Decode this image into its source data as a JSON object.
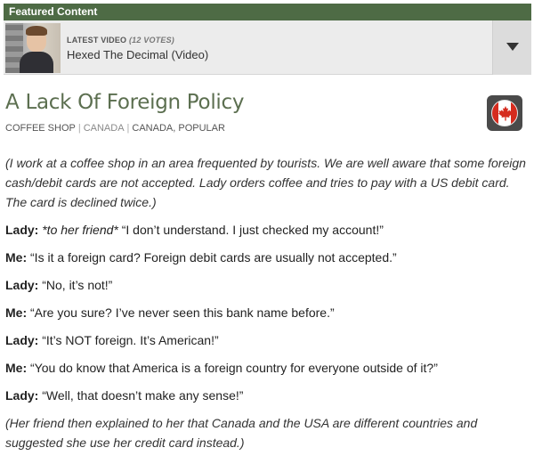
{
  "featured": {
    "header": "Featured Content",
    "kicker": "LATEST VIDEO",
    "votes": "(12 VOTES)",
    "title": "Hexed The Decimal (Video)"
  },
  "story": {
    "title": "A Lack Of Foreign Policy",
    "tags": [
      "COFFEE SHOP",
      "CANADA",
      "CANADA, POPULAR"
    ],
    "flag": "canada-flag-icon",
    "intro": "(I work at a coffee shop in an area frequented by tourists. We are well aware that some foreign cash/debit cards are not accepted. Lady orders coffee and tries to pay with a US debit card. The card is declined twice.)",
    "lines": [
      {
        "speaker": "Lady:",
        "aside": "*to her friend*",
        "text": " “I don’t understand. I just checked my account!”"
      },
      {
        "speaker": "Me:",
        "aside": "",
        "text": " “Is it a foreign card? Foreign debit cards are usually not accepted.”"
      },
      {
        "speaker": "Lady:",
        "aside": "",
        "text": " “No, it’s not!”"
      },
      {
        "speaker": "Me:",
        "aside": "",
        "text": " “Are you sure? I’ve never seen this bank name before.”"
      },
      {
        "speaker": "Lady:",
        "aside": "",
        "text": " “It’s NOT foreign. It’s American!”"
      },
      {
        "speaker": "Me:",
        "aside": "",
        "text": " “You do know that America is a foreign country for everyone outside of it?”"
      },
      {
        "speaker": "Lady:",
        "aside": "",
        "text": " “Well, that doesn’t make any sense!”"
      }
    ],
    "outro": "(Her friend then explained to her that Canada and the USA are different countries and suggested she use her credit card instead.)"
  },
  "colors": {
    "header_bg": "#4e6b45",
    "title": "#5c6f50",
    "flag_red": "#d52b1e"
  }
}
